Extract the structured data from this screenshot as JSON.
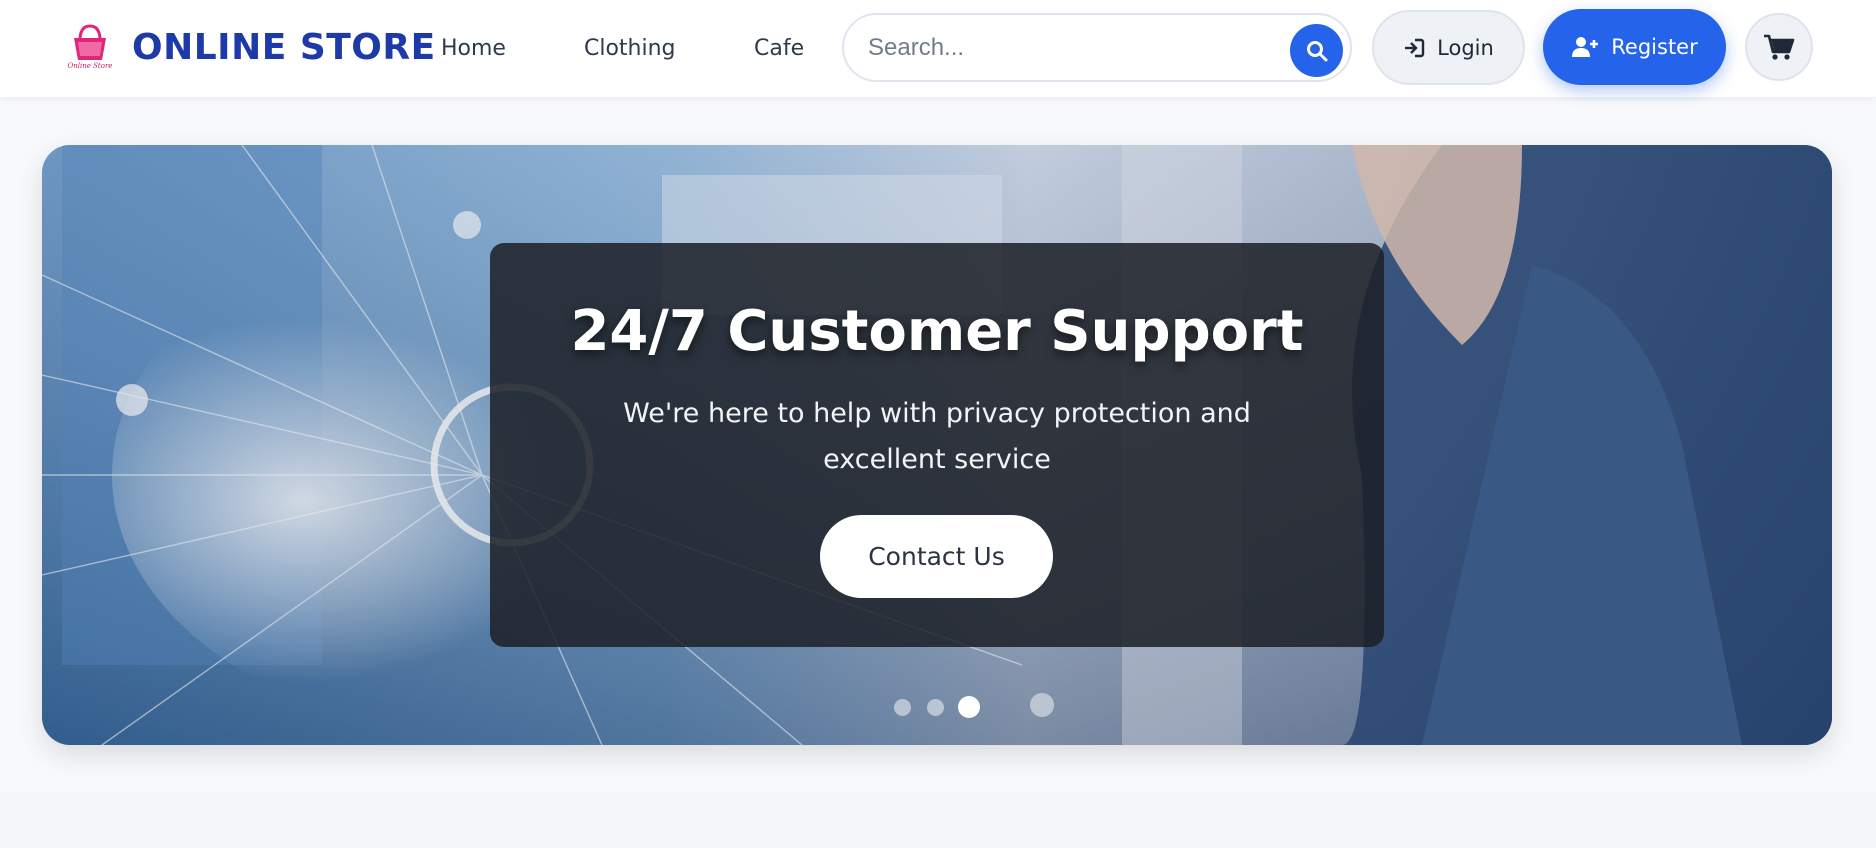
{
  "header": {
    "logo_text": "Online Store",
    "brand": "ONLINE STORE",
    "nav": [
      {
        "label": "Home"
      },
      {
        "label": "Clothing"
      },
      {
        "label": "Cafe"
      }
    ],
    "search": {
      "placeholder": "Search...",
      "value": ""
    },
    "login_label": "Login",
    "register_label": "Register"
  },
  "hero": {
    "title": "24/7 Customer Support",
    "subtitle": "We're here to help with privacy protection and excellent service",
    "cta_label": "Contact Us",
    "slides_count": 3,
    "active_slide": 3
  },
  "colors": {
    "brand": "#1e3aa8",
    "accent": "#2563eb",
    "logo_pink": "#e0257a"
  },
  "icons": {
    "search": "search-icon",
    "login": "sign-in-icon",
    "register": "user-plus-icon",
    "cart": "cart-icon"
  }
}
